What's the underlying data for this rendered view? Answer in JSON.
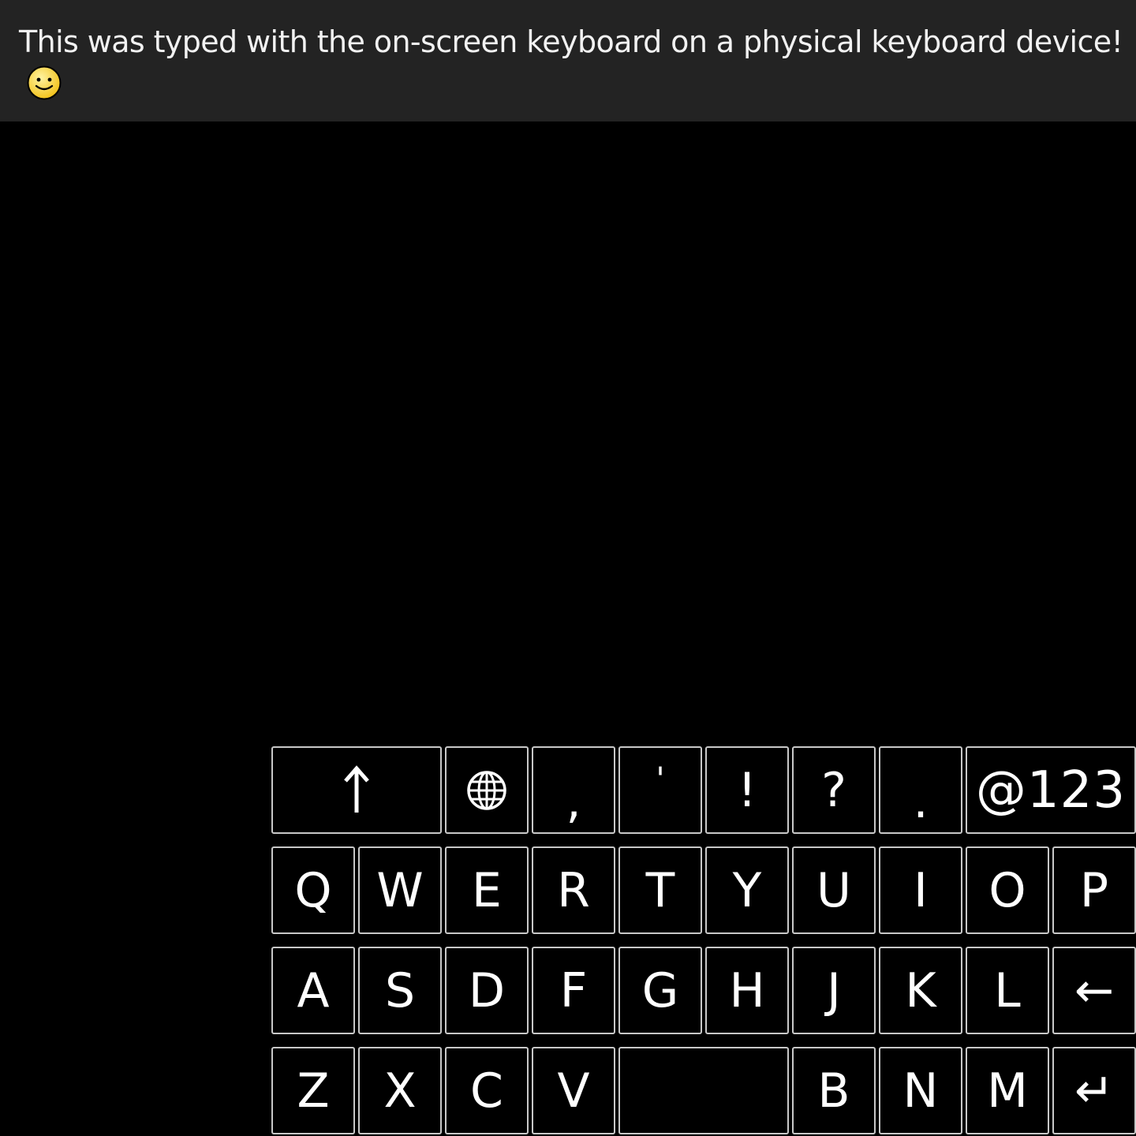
{
  "message": {
    "text": "This was typed with the on-screen keyboard on a physical keyboard device!",
    "emoji_icon": "smiling-face-icon"
  },
  "keyboard": {
    "row1": [
      {
        "name": "shift-key",
        "label": "↑",
        "icon": "shift-arrow-icon"
      },
      {
        "name": "language-key",
        "label": "",
        "icon": "globe-icon"
      },
      {
        "name": "comma-key",
        "label": ","
      },
      {
        "name": "apostrophe-key",
        "label": "'"
      },
      {
        "name": "exclamation-key",
        "label": "!"
      },
      {
        "name": "question-key",
        "label": "?"
      },
      {
        "name": "period-key",
        "label": "."
      },
      {
        "name": "symbols-key",
        "label": "@123"
      }
    ],
    "row2": [
      "Q",
      "W",
      "E",
      "R",
      "T",
      "Y",
      "U",
      "I",
      "O",
      "P"
    ],
    "row3": [
      "A",
      "S",
      "D",
      "F",
      "G",
      "H",
      "J",
      "K",
      "L",
      "←"
    ],
    "row4": [
      "Z",
      "X",
      "C",
      "V",
      "",
      "B",
      "N",
      "M",
      "↵"
    ]
  },
  "colors": {
    "background": "#000000",
    "message_bar": "#232323",
    "message_text": "#f2f2f2",
    "key_border": "#c8c8c8",
    "emoji_face": "#f7d33a"
  }
}
